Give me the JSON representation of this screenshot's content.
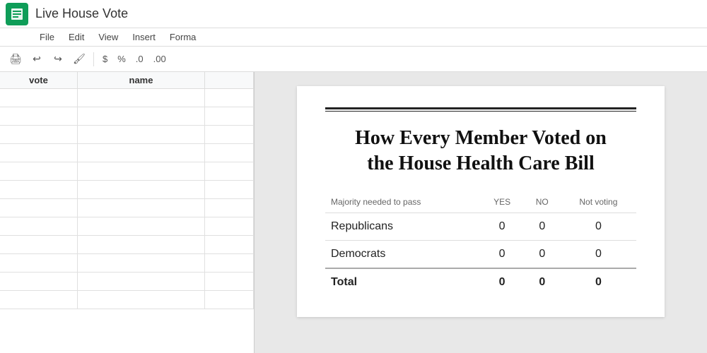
{
  "app": {
    "title": "Live House Vote",
    "logo_label": "Google Sheets"
  },
  "menu": {
    "items": [
      "File",
      "Edit",
      "View",
      "Insert",
      "Forma"
    ]
  },
  "toolbar": {
    "buttons": [
      "print",
      "undo",
      "redo",
      "paint-format",
      "dollar",
      "percent",
      "decimal-less",
      "decimal-more"
    ]
  },
  "spreadsheet": {
    "columns": [
      "vote",
      "name"
    ],
    "rows": [
      {
        "vote": "",
        "name": ""
      },
      {
        "vote": "",
        "name": ""
      },
      {
        "vote": "",
        "name": ""
      },
      {
        "vote": "",
        "name": ""
      },
      {
        "vote": "",
        "name": ""
      },
      {
        "vote": "",
        "name": ""
      },
      {
        "vote": "",
        "name": ""
      },
      {
        "vote": "",
        "name": ""
      },
      {
        "vote": "",
        "name": ""
      },
      {
        "vote": "",
        "name": ""
      },
      {
        "vote": "",
        "name": ""
      },
      {
        "vote": "",
        "name": ""
      },
      {
        "vote": "",
        "name": ""
      }
    ]
  },
  "article": {
    "title_line1": "How Every Member Voted on",
    "title_line2": "the House Health Care Bill",
    "majority_label": "Majority needed to pass",
    "columns": {
      "yes": "YES",
      "no": "NO",
      "not_voting": "Not voting"
    },
    "rows": [
      {
        "label": "Republicans",
        "yes": "0",
        "no": "0",
        "not_voting": "0"
      },
      {
        "label": "Democrats",
        "yes": "0",
        "no": "0",
        "not_voting": "0"
      }
    ],
    "total": {
      "label": "Total",
      "yes": "0",
      "no": "0",
      "not_voting": "0"
    }
  }
}
